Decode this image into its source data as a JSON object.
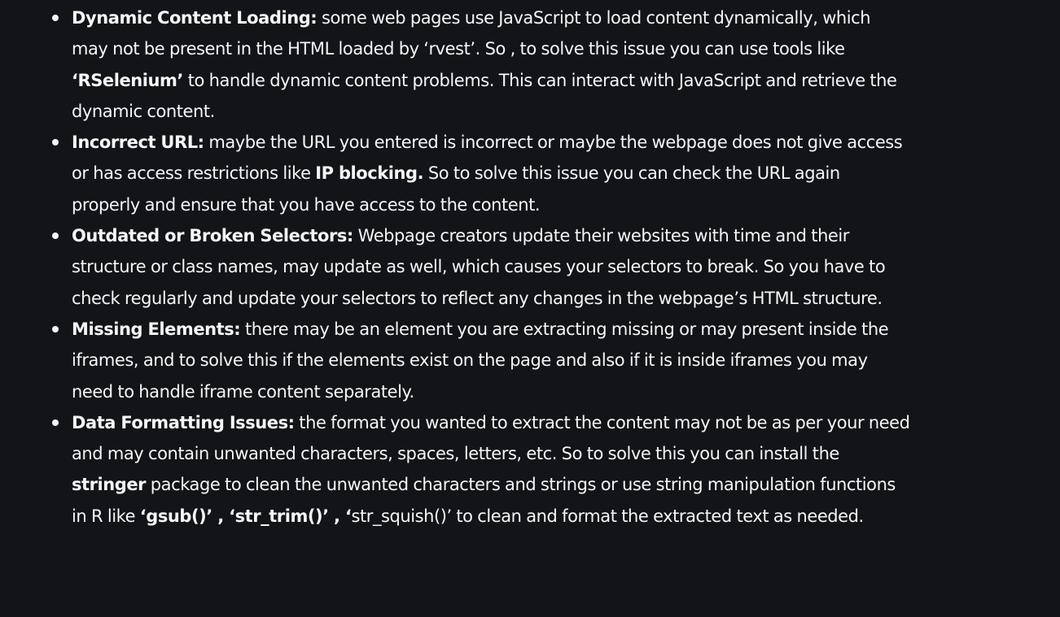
{
  "article": {
    "items": [
      {
        "title": "Dynamic Content Loading:",
        "text_1": " some web pages use JavaScript to load content dynamically, which may not be present in the HTML loaded by ‘rvest’. So , to solve this issue you can use tools like ",
        "bold_1": "‘RSelenium’",
        "text_2": " to handle dynamic content problems. This can interact with JavaScript and retrieve the dynamic content."
      },
      {
        "title": "Incorrect URL:",
        "text_1": " maybe the URL you entered is incorrect or maybe the webpage does not give access or has access restrictions like ",
        "bold_1": "IP blocking.",
        "text_2": " So to solve this issue you can check the URL again properly and ensure that you have access to the content."
      },
      {
        "title": "Outdated or Broken Selectors:",
        "text_1": " Webpage creators update their websites with time and their structure or class names, may update as well, which causes your selectors to break. So you have to check regularly and update your selectors to reflect any changes in the webpage’s HTML structure."
      },
      {
        "title": "Missing Elements:",
        "text_1": " there may be an element you are extracting missing or may present inside the iframes, and to solve this if the elements exist on the page and also if it is inside iframes you may need to handle iframe content separately."
      },
      {
        "title": "Data Formatting Issues:",
        "text_1": " the format you wanted to extract the content may not be as per your need and may contain unwanted characters, spaces, letters, etc. So to solve this you can install the ",
        "bold_1": "stringer",
        "text_2": " package to clean the unwanted characters and strings or use string manipulation functions in R like ",
        "bold_2": "‘gsub()’ , ‘str_trim()’ , ‘",
        "text_3": "str_squish()’ to clean and format the extracted text as needed."
      }
    ]
  },
  "colors": {
    "background": "#131417",
    "text": "#f5f6f7"
  }
}
